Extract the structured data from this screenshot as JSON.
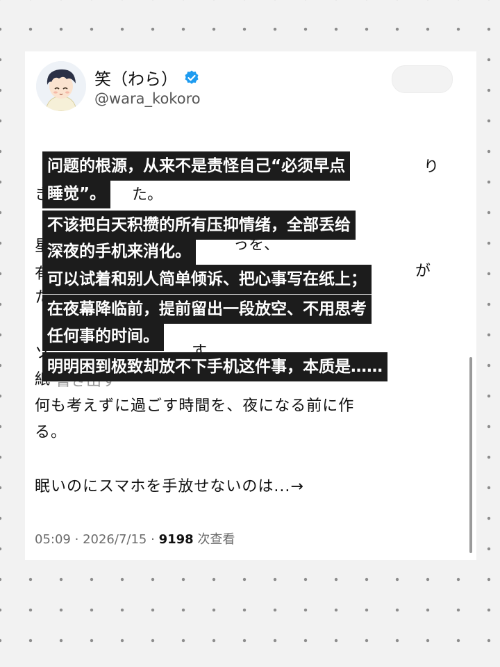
{
  "post": {
    "display_name": "笑（わら）",
    "handle": "@wara_kokoro",
    "verified_icon": "verified-badge-icon",
    "japanese_fragments": {
      "f1": "り",
      "f2": "き",
      "f3": "た。",
      "f4": "星",
      "f5": "っを、",
      "f6": "有",
      "f7": "た",
      "f8": "が",
      "f9": "た",
      "f10": "ソ",
      "f11": "す。",
      "f12": "紙",
      "f13": "書き出す"
    },
    "japanese_lines": [
      "何も考えずに過ごす時間を、夜になる前に作",
      "る。",
      "眠いのにスマホを手放せないのは...→"
    ],
    "time": "05:09",
    "date": "2026/7/15",
    "sep": "·",
    "views_count": "9198",
    "views_label": "次查看"
  },
  "overlay": {
    "lines": [
      "问题的根源，从来不是责怪自己“必须早点",
      "睡觉”。",
      "不该把白天积攒的所有压抑情绪，全部丢给",
      "深夜的手机来消化。",
      "可以试着和别人简单倾诉、把心事写在纸上；",
      "在夜幕降临前，提前留出一段放空、不用思考",
      "任何事的时间。",
      "明明困到极致却放不下手机这件事，本质是……"
    ]
  },
  "colors": {
    "background": "#f2f2f2",
    "card": "#ffffff",
    "overlay_bg": "#1c1c1c",
    "verified": "#1d9bf0"
  }
}
